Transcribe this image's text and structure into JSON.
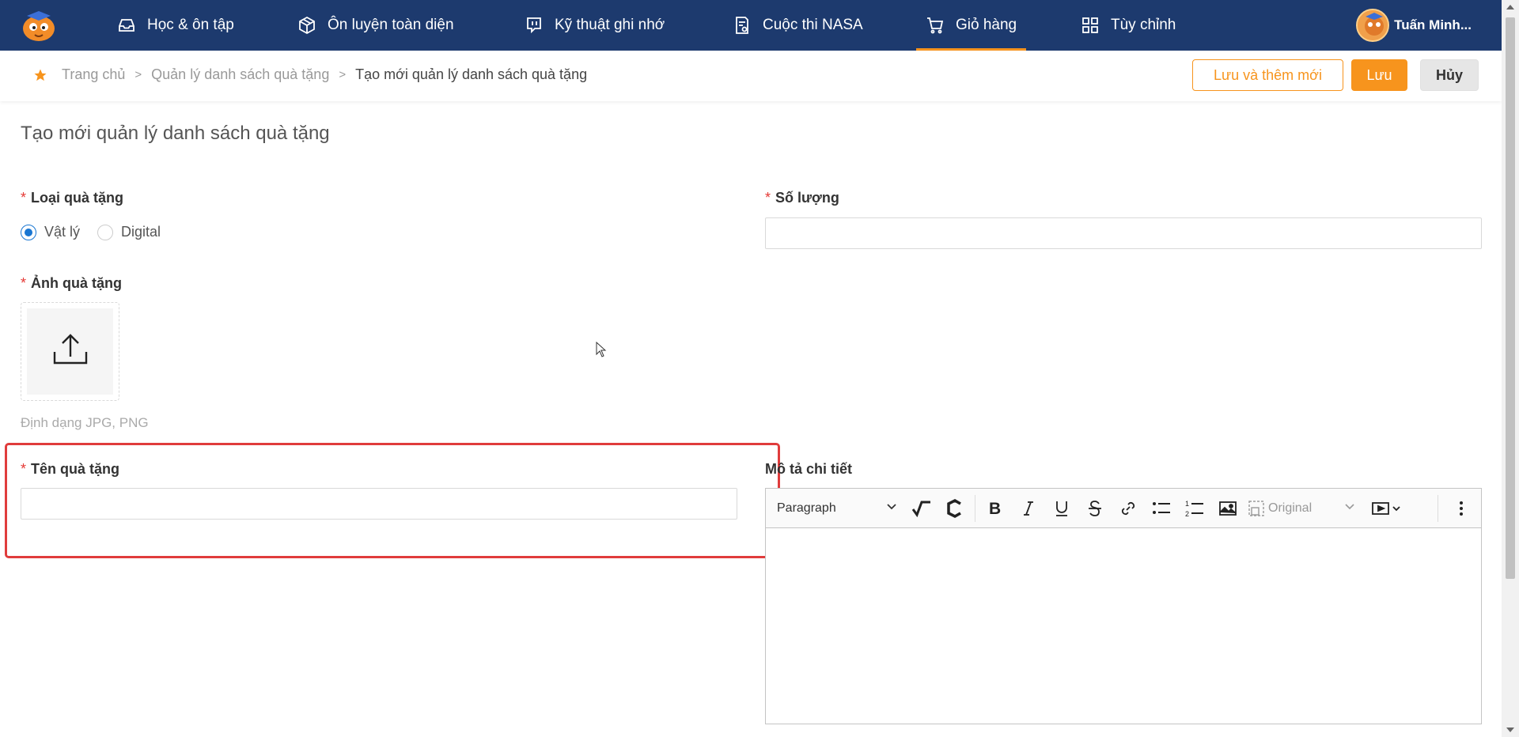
{
  "nav": {
    "items": [
      {
        "label": "Học & ôn tập",
        "icon": "inbox-icon"
      },
      {
        "label": "Ôn luyện toàn diện",
        "icon": "cube-icon"
      },
      {
        "label": "Kỹ thuật ghi nhớ",
        "icon": "chat-bubble-icon"
      },
      {
        "label": "Cuộc thi NASA",
        "icon": "document-icon"
      },
      {
        "label": "Giỏ hàng",
        "icon": "cart-icon",
        "active": true
      },
      {
        "label": "Tùy chỉnh",
        "icon": "grid-icon"
      }
    ],
    "user_name": "Tuấn Minh..."
  },
  "breadcrumb": {
    "home": "Trang chủ",
    "parent": "Quản lý danh sách quà tặng",
    "current": "Tạo mới quản lý danh sách quà tặng",
    "separator": ">"
  },
  "actions": {
    "save_and_new": "Lưu và thêm mới",
    "save": "Lưu",
    "cancel": "Hủy"
  },
  "form": {
    "title": "Tạo mới quản lý danh sách quà tặng",
    "required_mark": "*",
    "gift_type": {
      "label": "Loại quà tặng",
      "options": [
        "Vật lý",
        "Digital"
      ],
      "selected": "Vật lý"
    },
    "quantity": {
      "label": "Số lượng",
      "value": ""
    },
    "image": {
      "label": "Ảnh quà tặng",
      "hint": "Định dạng JPG, PNG"
    },
    "gift_name": {
      "label": "Tên quà tặng",
      "value": ""
    },
    "description": {
      "label": "Mô tả chi tiết",
      "paragraph_style": "Paragraph",
      "image_size": "Original"
    }
  },
  "colors": {
    "nav_bg": "#1d3a6e",
    "accent": "#f7941d",
    "required": "#e53935",
    "radio_checked": "#1976d2",
    "highlight": "#e03c3c"
  }
}
